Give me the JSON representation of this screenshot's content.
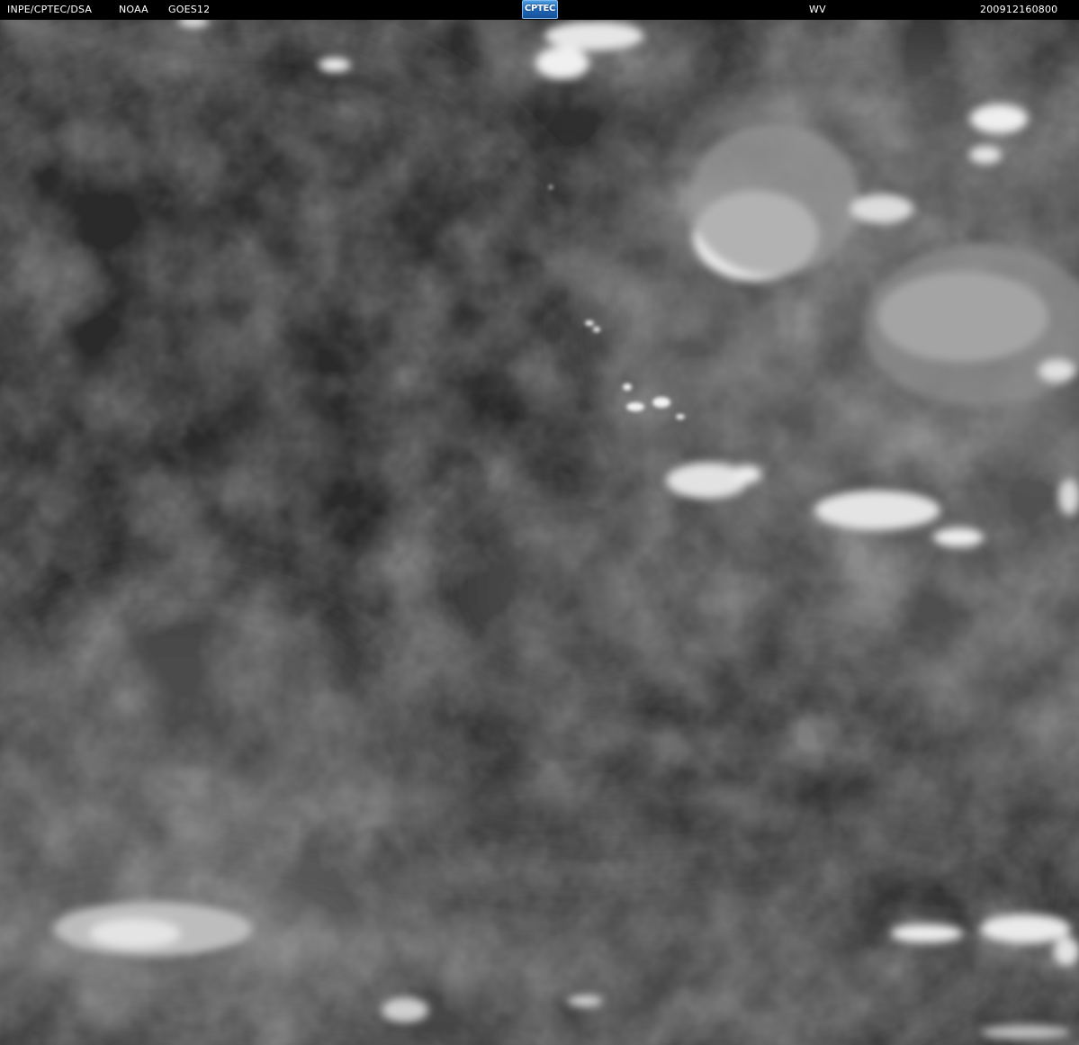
{
  "header": {
    "source": "INPE/CPTEC/DSA",
    "agency": "NOAA",
    "satellite": "GOES12",
    "channel": "WV",
    "timestamp": "200912160800"
  },
  "logo": {
    "text": "CPTEC",
    "colors": {
      "fill": "#2a79cc",
      "text": "#ffffff"
    }
  },
  "image": {
    "kind": "satellite-water-vapor-grayscale",
    "colors": {
      "dark_region": "#2e2e2e",
      "mid_region": "#4a4a4a",
      "cloud": "#e8e8e8"
    }
  }
}
